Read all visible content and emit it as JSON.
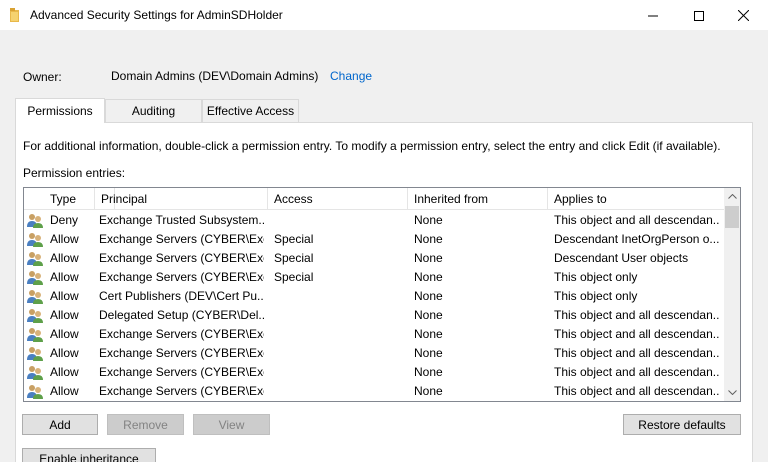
{
  "window": {
    "title": "Advanced Security Settings for AdminSDHolder"
  },
  "owner": {
    "label": "Owner:",
    "value": "Domain Admins (DEV\\Domain Admins)",
    "change_link": "Change"
  },
  "tabs": [
    {
      "label": "Permissions",
      "active": true
    },
    {
      "label": "Auditing",
      "active": false
    },
    {
      "label": "Effective Access",
      "active": false
    }
  ],
  "permissions": {
    "info_text": "For additional information, double-click a permission entry. To modify a permission entry, select the entry and click Edit (if available).",
    "entries_label": "Permission entries:",
    "columns": [
      "Type",
      "Principal",
      "Access",
      "Inherited from",
      "Applies to"
    ],
    "rows": [
      {
        "type": "Deny",
        "principal": "Exchange Trusted Subsystem...",
        "access": "",
        "inherited": "None",
        "applies": "This object and all descendan..."
      },
      {
        "type": "Allow",
        "principal": "Exchange Servers (CYBER\\Exc...",
        "access": "Special",
        "inherited": "None",
        "applies": "Descendant InetOrgPerson o..."
      },
      {
        "type": "Allow",
        "principal": "Exchange Servers (CYBER\\Exc...",
        "access": "Special",
        "inherited": "None",
        "applies": "Descendant User objects"
      },
      {
        "type": "Allow",
        "principal": "Exchange Servers (CYBER\\Exc...",
        "access": "Special",
        "inherited": "None",
        "applies": "This object only"
      },
      {
        "type": "Allow",
        "principal": "Cert Publishers (DEV\\Cert Pu...",
        "access": "",
        "inherited": "None",
        "applies": "This object only"
      },
      {
        "type": "Allow",
        "principal": "Delegated Setup (CYBER\\Del...",
        "access": "",
        "inherited": "None",
        "applies": "This object and all descendan..."
      },
      {
        "type": "Allow",
        "principal": "Exchange Servers (CYBER\\Exc...",
        "access": "",
        "inherited": "None",
        "applies": "This object and all descendan..."
      },
      {
        "type": "Allow",
        "principal": "Exchange Servers (CYBER\\Exc...",
        "access": "",
        "inherited": "None",
        "applies": "This object and all descendan..."
      },
      {
        "type": "Allow",
        "principal": "Exchange Servers (CYBER\\Exc...",
        "access": "",
        "inherited": "None",
        "applies": "This object and all descendan..."
      },
      {
        "type": "Allow",
        "principal": "Exchange Servers (CYBER\\Exc...",
        "access": "",
        "inherited": "None",
        "applies": "This object and all descendan..."
      }
    ]
  },
  "buttons": {
    "add": "Add",
    "remove": "Remove",
    "view": "View",
    "restore_defaults": "Restore defaults",
    "enable_inheritance": "Enable inheritance"
  },
  "icons": {
    "row_icon": "users-group-icon",
    "title_icon": "folder-icon"
  },
  "colors": {
    "link": "#0066cc",
    "disabled_text": "#838383"
  }
}
